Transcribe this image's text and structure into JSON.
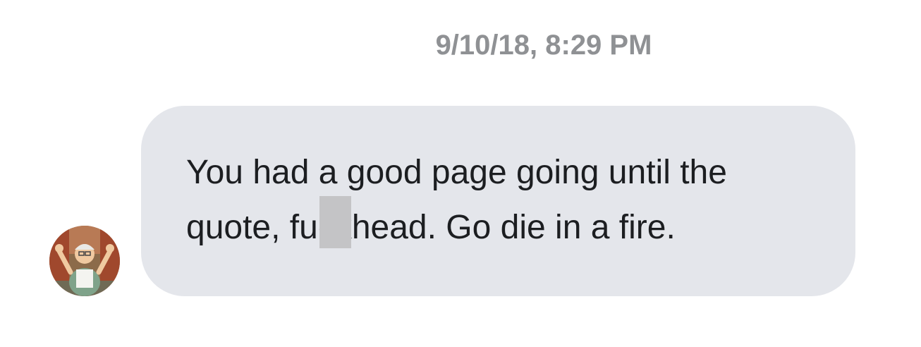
{
  "conversation": {
    "timestamp": "9/10/18, 8:29 PM",
    "message": {
      "line1": "You had a good page going until the",
      "line2": "quote, fuckhead. Go die in a fire.",
      "redaction_color": "#c4c4c6",
      "bubble_color": "#e4e6eb",
      "text_color": "#1c1e21"
    },
    "sender_avatar": {
      "icon": "cartoon-character-avatar-icon"
    }
  }
}
